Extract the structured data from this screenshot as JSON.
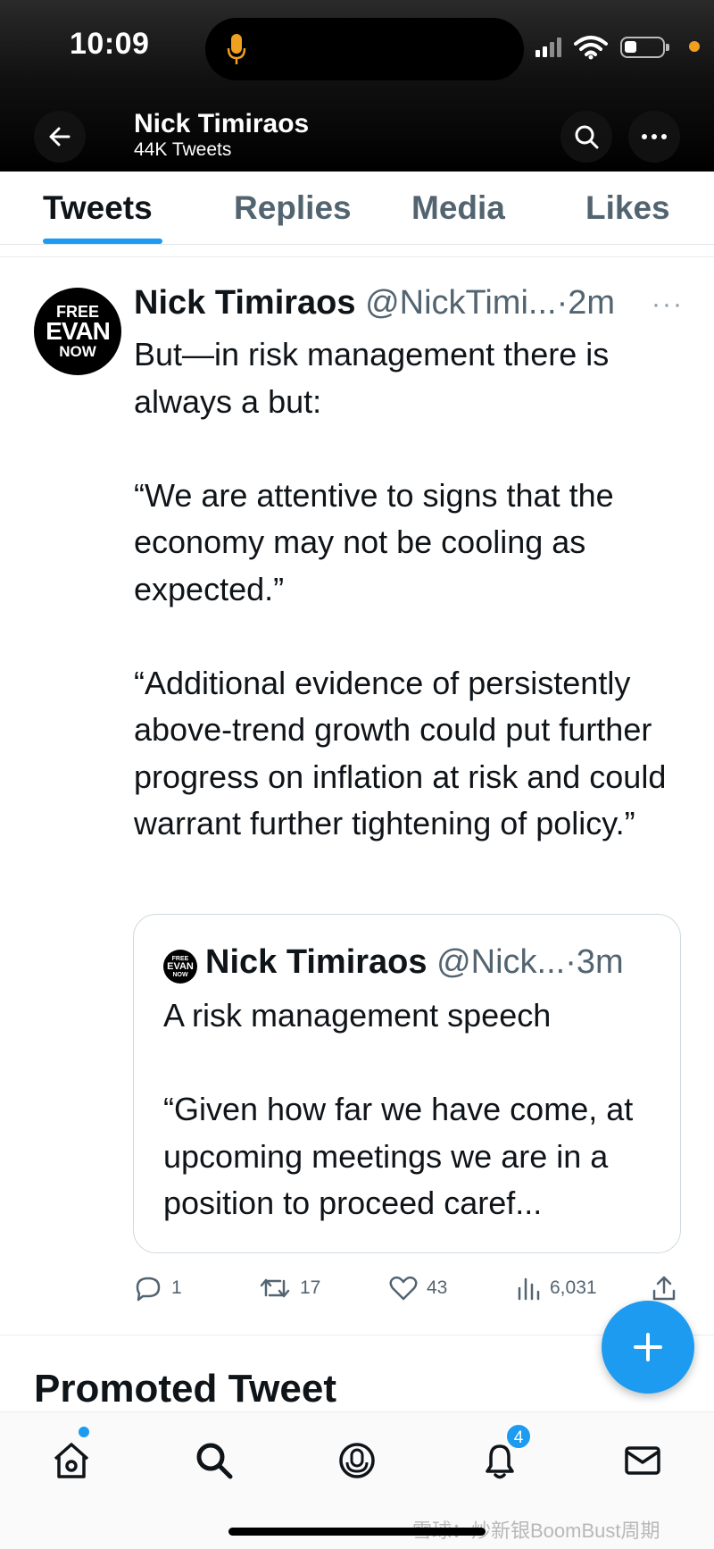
{
  "status_bar": {
    "time": "10:09"
  },
  "header": {
    "name": "Nick Timiraos",
    "tweet_count": "44K Tweets"
  },
  "tabs": [
    {
      "label": "Tweets",
      "active": true
    },
    {
      "label": "Replies",
      "active": false
    },
    {
      "label": "Media",
      "active": false
    },
    {
      "label": "Likes",
      "active": false
    }
  ],
  "tweet": {
    "avatar_text": [
      "FREE",
      "EVAN",
      "NOW"
    ],
    "author_name": "Nick Timiraos",
    "handle": "@NickTimi...",
    "time": "·2m",
    "more": "···",
    "text": "But—in risk management there is always a but:\n\n“We are attentive to signs that the economy may not be cooling as expected.”\n\n“Additional evidence of persistently above-trend growth could put further progress on inflation at risk and could warrant further tightening of policy.”",
    "quote": {
      "author_name": "Nick Timiraos",
      "handle": "@Nick...",
      "time": "·3m",
      "text": "A risk management speech\n\n“Given how far we have come, at upcoming meetings we are in a position to proceed caref..."
    },
    "actions": {
      "replies": "1",
      "retweets": "17",
      "likes": "43",
      "views": "6,031"
    }
  },
  "promoted": {
    "title": "Promoted Tweet"
  },
  "bottom_nav": {
    "notification_badge": "4"
  },
  "watermark": "雪球：炒新银BoomBust周期",
  "colors": {
    "accent": "#1d9bf0",
    "text_primary": "#0f1419",
    "text_secondary": "#536471"
  }
}
